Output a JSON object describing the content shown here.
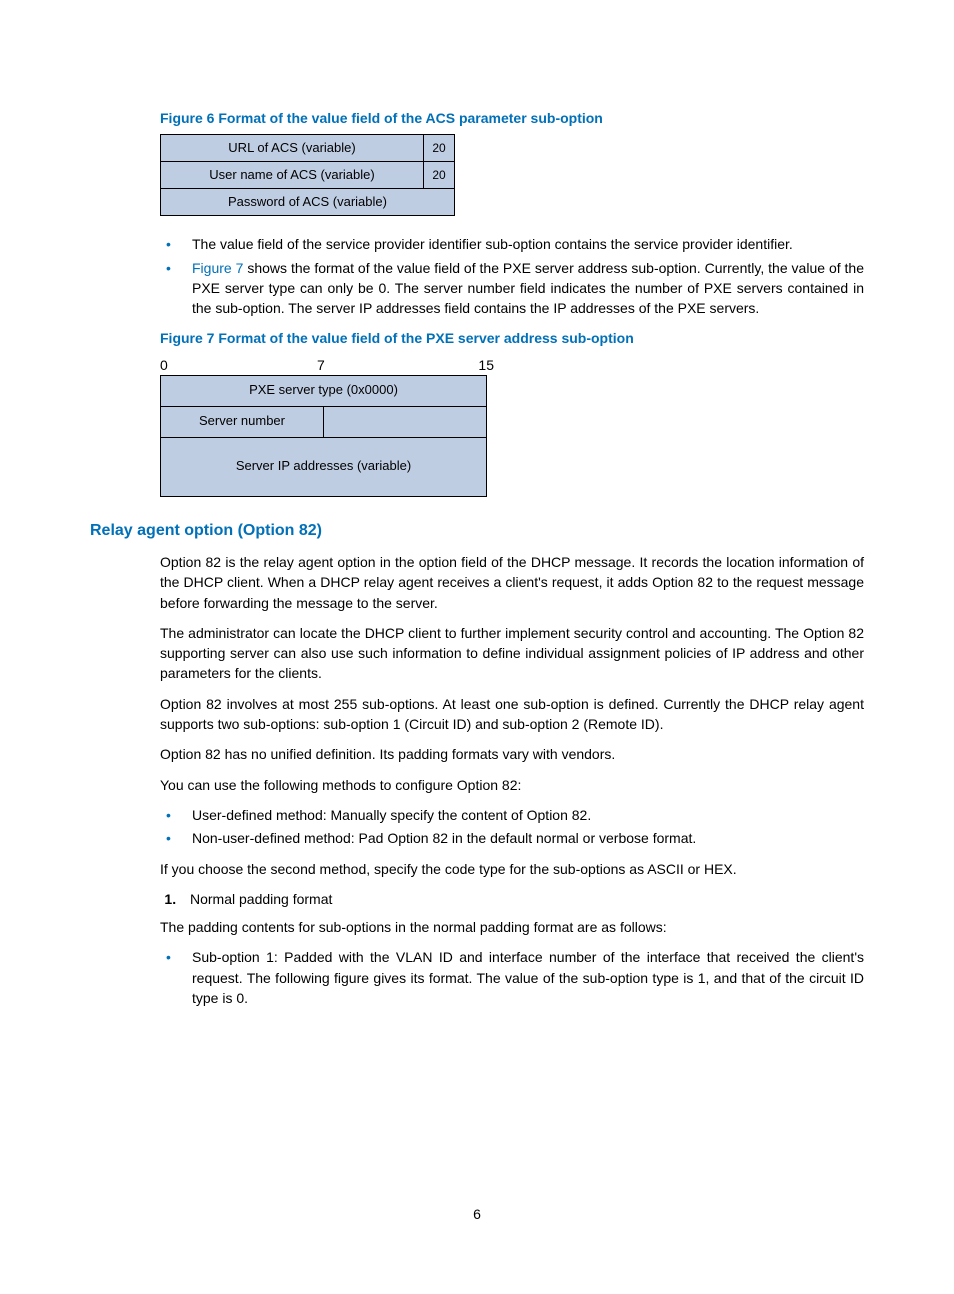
{
  "figure6": {
    "title": "Figure 6 Format of the value field of the ACS parameter sub-option",
    "rows": [
      {
        "label": "URL of ACS (variable)",
        "tag": "20"
      },
      {
        "label": "User name of ACS (variable)",
        "tag": "20"
      },
      {
        "label": "Password of ACS (variable)",
        "tag": ""
      }
    ]
  },
  "bullets_after_fig6": [
    "The value field of the service provider identifier sub-option contains the service provider identifier.",
    " shows the format of the value field of the PXE server address sub-option. Currently, the value of the PXE server type can only be 0. The server number field indicates the number of PXE servers contained in the sub-option. The server IP addresses field contains the IP addresses of the PXE servers."
  ],
  "figure7_link": "Figure 7",
  "figure7": {
    "title": "Figure 7 Format of the value field of the PXE server address sub-option",
    "labels": {
      "l0": "0",
      "l7": "7",
      "l15": "15"
    },
    "row1": "PXE server type (0x0000)",
    "row2_left": "Server number",
    "row3": "Server IP addresses (variable)"
  },
  "section": {
    "title": "Relay agent option (Option 82)",
    "p1": "Option 82 is the relay agent option in the option field of the DHCP message. It records the location information of the DHCP client. When a DHCP relay agent receives a client's request, it adds Option 82 to the request message before forwarding the message to the server.",
    "p2": "The administrator can locate the DHCP client to further implement security control and accounting. The Option 82 supporting server can also use such information to define individual assignment policies of IP address and other parameters for the clients.",
    "p3": "Option 82 involves at most 255 sub-options. At least one sub-option is defined. Currently the DHCP relay agent supports two sub-options: sub-option 1 (Circuit ID) and sub-option 2 (Remote ID).",
    "p4": "Option 82 has no unified definition. Its padding formats vary with vendors.",
    "p5": "You can use the following methods to configure Option 82:",
    "methods": [
      "User-defined method: Manually specify the content of Option 82.",
      "Non-user-defined method: Pad Option 82 in the default normal or verbose format."
    ],
    "p6": "If you choose the second method, specify the code type for the sub-options as ASCII or HEX.",
    "num1": "Normal padding format",
    "p7": "The padding contents for sub-options in the normal padding format are as follows:",
    "sub1": "Sub-option 1: Padded with the VLAN ID and interface number of the interface that received the client's request. The following figure gives its format. The value of the sub-option type is 1, and that of the circuit ID type is 0."
  },
  "page_number": "6"
}
